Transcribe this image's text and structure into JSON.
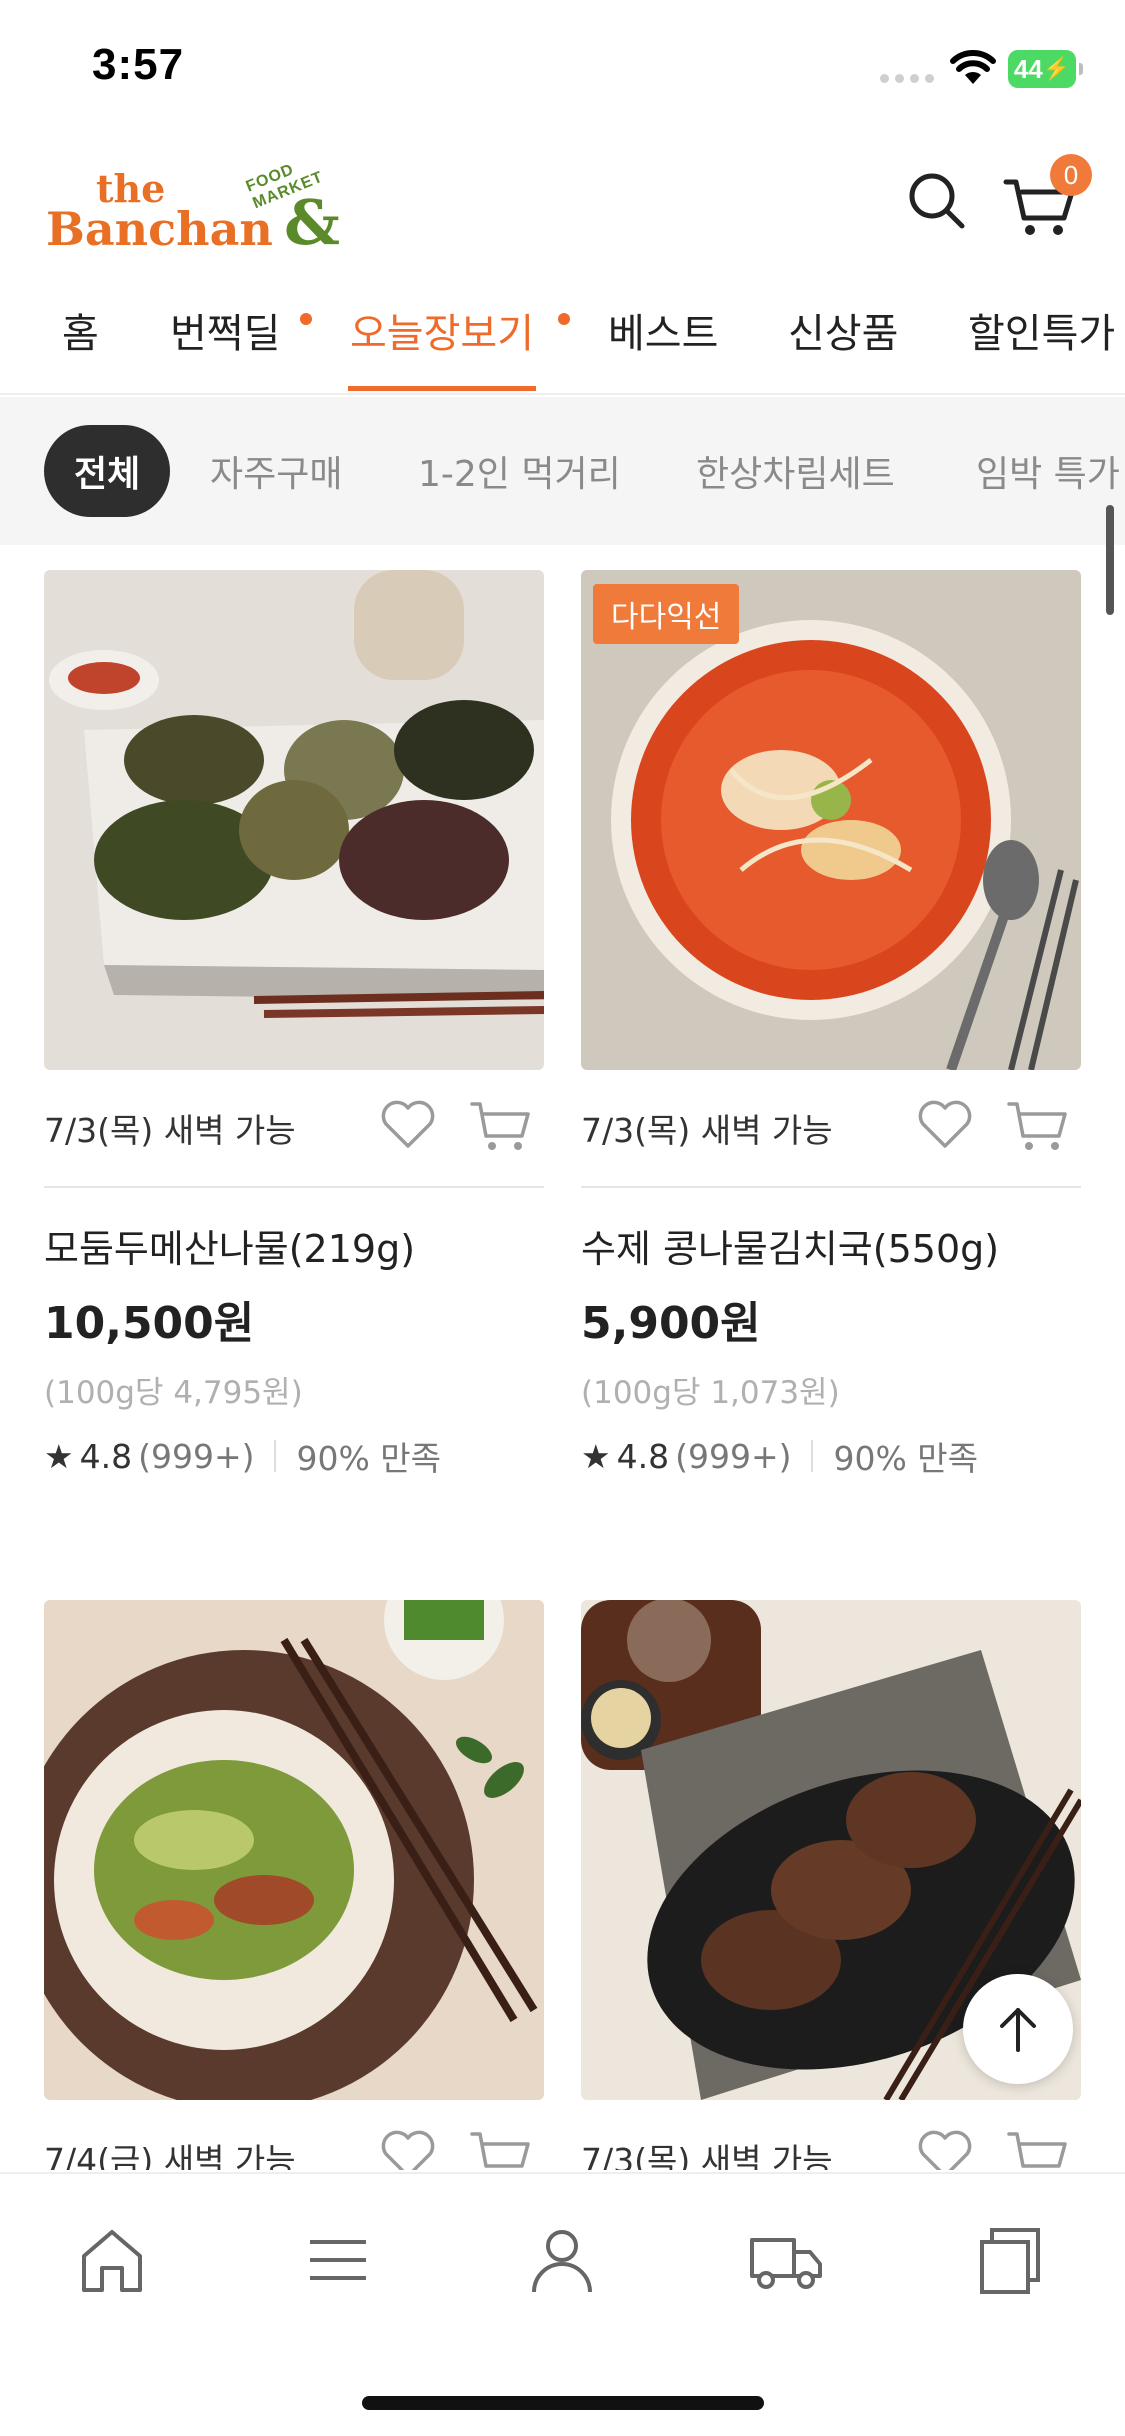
{
  "status_bar": {
    "time": "3:57",
    "battery": "44"
  },
  "header": {
    "logo": {
      "line1": "the",
      "line2": "Banchan",
      "amp": "&",
      "tag": "FOOD MARKET"
    },
    "cart_count": "0"
  },
  "main_tabs": [
    {
      "label": "홈",
      "dot": false,
      "active": false
    },
    {
      "label": "번쩍딜",
      "dot": true,
      "active": false
    },
    {
      "label": "오늘장보기",
      "dot": true,
      "active": true
    },
    {
      "label": "베스트",
      "dot": false,
      "active": false
    },
    {
      "label": "신상품",
      "dot": false,
      "active": false
    },
    {
      "label": "할인특가",
      "dot": false,
      "active": false
    }
  ],
  "sub_tabs": [
    {
      "label": "전체",
      "active": true
    },
    {
      "label": "자주구매",
      "active": false
    },
    {
      "label": "1-2인 먹거리",
      "active": false
    },
    {
      "label": "한상차림세트",
      "active": false
    },
    {
      "label": "임박 특가",
      "active": false
    }
  ],
  "products": [
    {
      "delivery": "7/3(목) 새벽 가능",
      "name": "모둠두메산나물(219g)",
      "price": "10,500원",
      "unit_price": "(100g당 4,795원)",
      "rating": "4.8",
      "reviews": "(999+)",
      "satisfaction": "90% 만족",
      "badge": ""
    },
    {
      "delivery": "7/3(목) 새벽 가능",
      "name": "수제 콩나물김치국(550g)",
      "price": "5,900원",
      "unit_price": "(100g당 1,073원)",
      "rating": "4.8",
      "reviews": "(999+)",
      "satisfaction": "90% 만족",
      "badge": "다다익선"
    },
    {
      "delivery": "7/4(금) 새벽 가능",
      "badge": ""
    },
    {
      "delivery": "7/3(목) 새벽 가능",
      "badge": ""
    }
  ],
  "star_glyph": "★",
  "colors": {
    "accent": "#ef6a2b",
    "logo_green": "#5a8a2a",
    "active_chip": "#2e2e2e"
  }
}
